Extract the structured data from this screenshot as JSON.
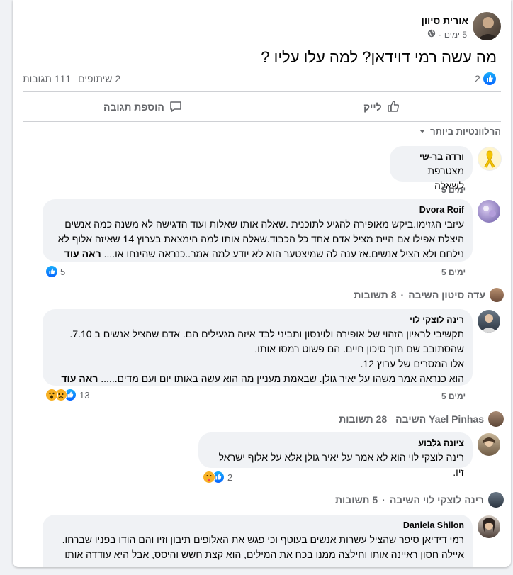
{
  "post": {
    "author": "אורית סיוון",
    "time": "5 ימים",
    "text": "מה עשה רמי דוידאן? למה עלו עליו ?",
    "reactions_count": "2",
    "comments_count": "111 תגובות",
    "shares_count": "2 שיתופים"
  },
  "actions": {
    "like_label": "לייק",
    "comment_label": "הוספת תגובה"
  },
  "sort": {
    "label": "הרלוונטיות ביותר"
  },
  "comments": [
    {
      "name": "ורדה בר-שי",
      "text": "מצטרפת לשאלה",
      "time": "5 ימים"
    },
    {
      "name": "Dvora Roif",
      "lines": [
        "עיזבי הגזימו.ביקש מאופירה להגיע לתוכנית .שאלה אותו שאלות ועוד הדגישה לא משנה כמה אנשים",
        "היצלת אפילו אם היית מציל אדם אחד כל הכבוד.שאלה אותו למה הימצאת בערוץ 14 שאיזה אלוף לא",
        "ניל​חם ולא הציל אנשים.אז ענה לה שמיצטער הוא לא יודע למה אמר..כנראה שהינחו או...."
      ],
      "see_more": "ראה עוד",
      "reactions": "5",
      "time": "5 ימים",
      "replies_author": "עדה סיטון השיבה",
      "replies_count": "8 תשובות"
    },
    {
      "name": "רינה לוצקי לוי",
      "lines": [
        "תקשיבי לראיון הזה​וי של אופירה ולוינסון ותביני לבד איזה מגעילים הם. אדם שהציל אנשים ב 7.10.",
        "שהסתובב שם תוך סיכון חיים. הם פשוט רמסו אותו.",
        "אלו המסרים של ערוץ 12.",
        "הוא כנראה אמר משהו על יאיר גולן. שבאמת מעניין מה הוא עשה באותו יום ועם מדים......"
      ],
      "see_more": "ראה עוד",
      "reactions": "13",
      "time": "5 ימים",
      "replies_author": "Yael Pinhas השיבה",
      "replies_count": "28 תשובות"
    },
    {
      "name": "ציונה גלבוע",
      "text": "רינה לוצקי לוי הוא לא אמר על יאיר גולן אלא על אלוף ישראל זיו.",
      "reactions": "2",
      "replies_author": "רינה לוצקי לוי השיבה",
      "replies_count": "5 תשובות"
    },
    {
      "name": "Daniela Shilon",
      "lines": [
        "רמי דידיאן סיפר שהציל עשרות אנשים בעוטף וכי פגש את האלופים תיבון וזיו והם הודו בפניו שברחו.",
        "איילה חסון ראיינה אותו וחילצה ממנו בכח את המילים, הוא קצת חשש והיסס, אבל היא עודדה אותו"
      ]
    }
  ]
}
